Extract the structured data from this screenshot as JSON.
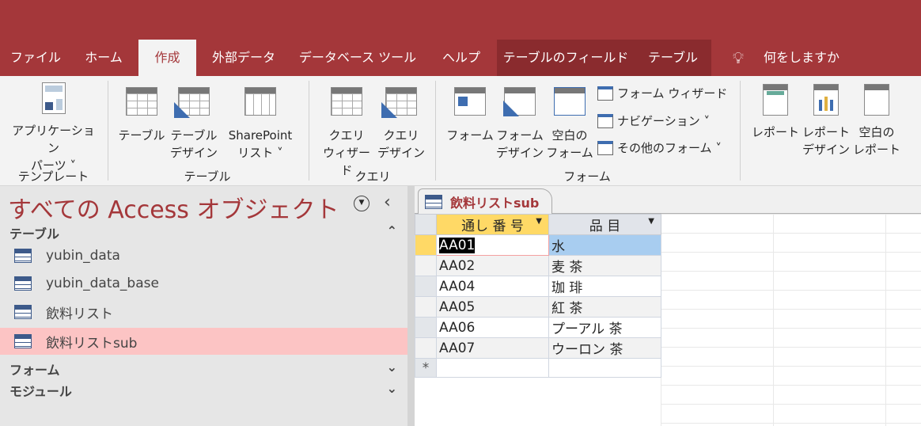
{
  "tabs": [
    "ファイル",
    "ホーム",
    "作成",
    "外部データ",
    "データベース ツール",
    "ヘルプ",
    "テーブルのフィールド",
    "テーブル"
  ],
  "tell_me": "何をしますか",
  "ribbon": {
    "groups": {
      "template": "テンプレート",
      "table": "テーブル",
      "query": "クエリ",
      "form": "フォーム"
    },
    "app_parts": [
      "アプリケーション",
      "パーツ ˅"
    ],
    "table": [
      "テーブル"
    ],
    "table_design": [
      "テーブル",
      "デザイン"
    ],
    "sharepoint": [
      "SharePoint",
      "リスト ˅"
    ],
    "query_wizard": [
      "クエリ",
      "ウィザード"
    ],
    "query_design": [
      "クエリ",
      "デザイン"
    ],
    "form": [
      "フォーム"
    ],
    "form_design": [
      "フォーム",
      "デザイン"
    ],
    "blank_form": [
      "空白の",
      "フォーム"
    ],
    "form_wizard": "フォーム ウィザード",
    "navigation": "ナビゲーション ˅",
    "more_forms": "その他のフォーム ˅",
    "report": [
      "レポート"
    ],
    "report_design": [
      "レポート",
      "デザイン"
    ],
    "blank_report": [
      "空白の",
      "レポート"
    ]
  },
  "nav": {
    "title": "すべての Access オブジェクト",
    "sections": {
      "tables": "テーブル",
      "forms": "フォーム",
      "modules": "モジュール"
    },
    "items": [
      "yubin_data",
      "yubin_data_base",
      "飲料リスト",
      "飲料リストsub"
    ]
  },
  "doc": {
    "tab": "飲料リストsub",
    "columns": [
      "通し 番 号",
      "品 目"
    ],
    "rows": [
      [
        "AA01",
        "水"
      ],
      [
        "AA02",
        "麦 茶"
      ],
      [
        "AA04",
        "珈 琲"
      ],
      [
        "AA05",
        "紅 茶"
      ],
      [
        "AA06",
        "プーアル 茶"
      ],
      [
        "AA07",
        "ウーロン 茶"
      ]
    ],
    "new_row_marker": "*"
  }
}
